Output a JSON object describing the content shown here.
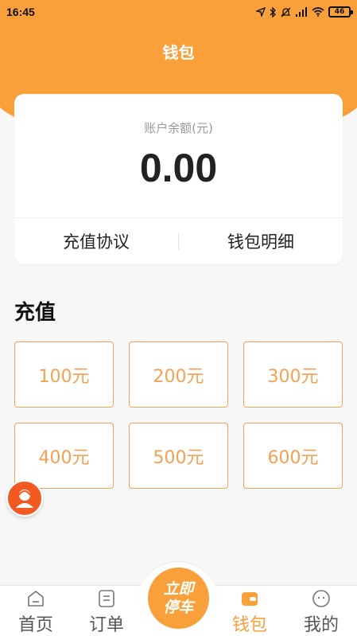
{
  "status_bar": {
    "time": "16:45",
    "battery": "46",
    "icons": [
      "location-icon",
      "bluetooth-icon",
      "mute-icon",
      "signal-icon",
      "wifi-icon",
      "battery-icon"
    ]
  },
  "header": {
    "title": "钱包"
  },
  "balance_card": {
    "label": "账户余额(元)",
    "amount": "0.00",
    "links": [
      "充值协议",
      "钱包明细"
    ]
  },
  "recharge": {
    "title": "充值",
    "options": [
      "100元",
      "200元",
      "300元",
      "400元",
      "500元",
      "600元"
    ]
  },
  "tab_bar": {
    "home": "首页",
    "orders": "订单",
    "center_line1": "立即",
    "center_line2": "停车",
    "wallet": "钱包",
    "mine": "我的"
  },
  "colors": {
    "accent": "#f9a03a",
    "option_border": "#f3a152",
    "avatar_bg": "#f15a22"
  }
}
